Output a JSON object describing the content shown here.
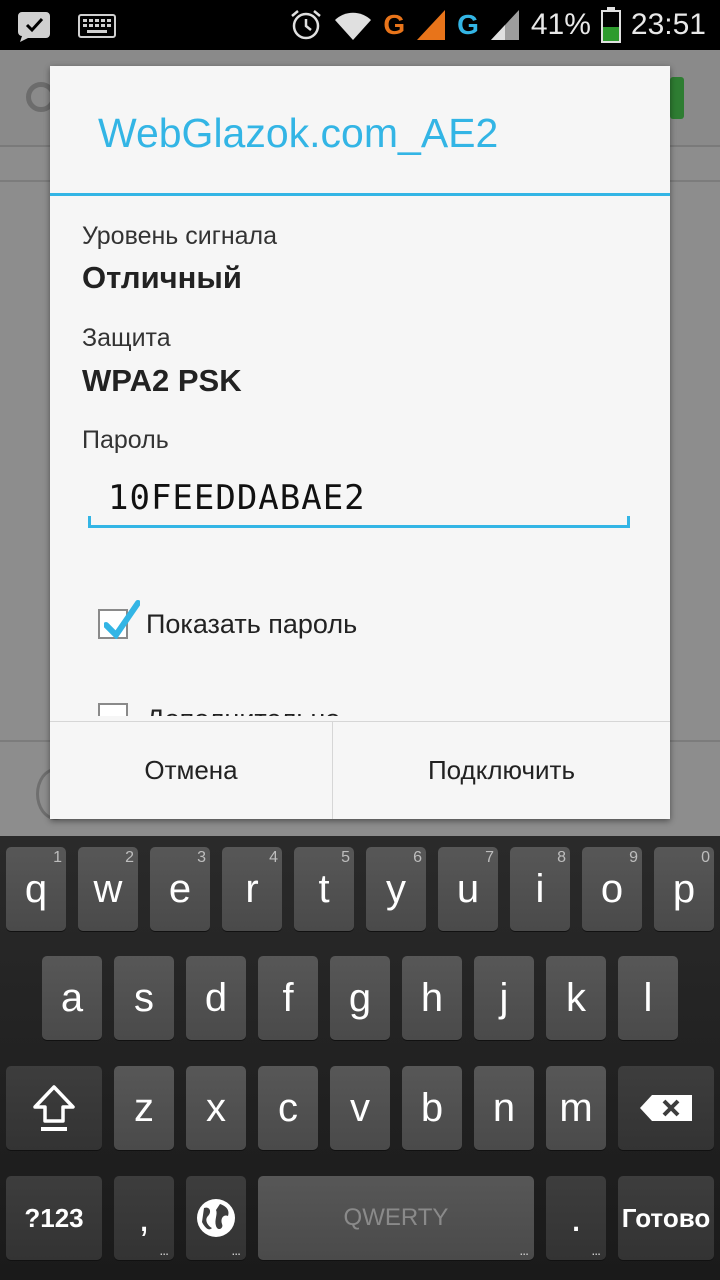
{
  "status_bar": {
    "battery_percent": "41%",
    "time": "23:51",
    "network_1": "G",
    "network_2": "G",
    "icons": [
      "chat-icon",
      "keyboard-icon",
      "alarm-icon",
      "wifi-icon",
      "signal-icon",
      "signal-icon",
      "battery-icon"
    ],
    "colors": {
      "net1": "#e8741a",
      "net2": "#33b5e5",
      "battery": "#2e9b2e"
    }
  },
  "dialog": {
    "title": "WebGlazok.com_AE2",
    "signal_label": "Уровень сигнала",
    "signal_value": "Отличный",
    "security_label": "Защита",
    "security_value": "WPA2 PSK",
    "password_label": "Пароль",
    "password_value": "10FEEDDABAE2",
    "show_password_label": "Показать пароль",
    "show_password_checked": true,
    "advanced_label": "Дополнительно",
    "cancel_label": "Отмена",
    "connect_label": "Подключить",
    "accent_color": "#33b5e5"
  },
  "keyboard": {
    "row1": [
      {
        "char": "q",
        "hint": "1"
      },
      {
        "char": "w",
        "hint": "2"
      },
      {
        "char": "e",
        "hint": "3"
      },
      {
        "char": "r",
        "hint": "4"
      },
      {
        "char": "t",
        "hint": "5"
      },
      {
        "char": "y",
        "hint": "6"
      },
      {
        "char": "u",
        "hint": "7"
      },
      {
        "char": "i",
        "hint": "8"
      },
      {
        "char": "o",
        "hint": "9"
      },
      {
        "char": "p",
        "hint": "0"
      }
    ],
    "row2": [
      "a",
      "s",
      "d",
      "f",
      "g",
      "h",
      "j",
      "k",
      "l"
    ],
    "row3": [
      "z",
      "x",
      "c",
      "v",
      "b",
      "n",
      "m"
    ],
    "symbols_label": "?123",
    "comma_label": ",",
    "space_label": "QWERTY",
    "period_label": ".",
    "done_label": "Готово",
    "shift_icon": "shift-icon",
    "backspace_icon": "backspace-icon",
    "globe_icon": "globe-icon"
  }
}
